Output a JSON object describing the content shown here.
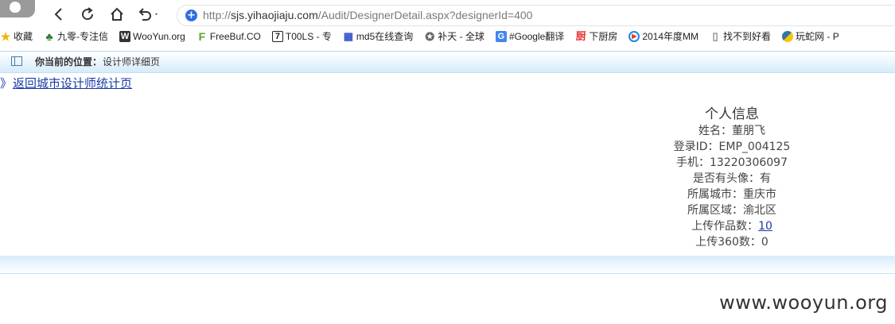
{
  "browser": {
    "url_prefix": "http://",
    "url_host": "sjs.yihaojiaju.com",
    "url_path": "/Audit/DesignerDetail.aspx?designerId=400"
  },
  "bookmarks": [
    {
      "label": "收藏",
      "icon": "star-icon",
      "color": "#f4b400"
    },
    {
      "label": "九零-专注信",
      "icon": "turtle-icon",
      "color": "#2e7d32"
    },
    {
      "label": "WooYun.org",
      "icon": "wooyun-icon",
      "color": "#333333"
    },
    {
      "label": "FreeBuf.CO",
      "icon": "freebuf-icon",
      "color": "#5aa02c"
    },
    {
      "label": "T00LS - 专",
      "icon": "tools-icon",
      "color": "#222222"
    },
    {
      "label": "md5在线查询",
      "icon": "grid-icon",
      "color": "#3355cc"
    },
    {
      "label": "补天 - 全球",
      "icon": "gear-star-icon",
      "color": "#666666"
    },
    {
      "label": "#Google翻译",
      "icon": "translate-icon",
      "color": "#4285f4"
    },
    {
      "label": "下厨房",
      "icon": "kitchen-icon",
      "color": "#e53935"
    },
    {
      "label": "2014年度MM",
      "icon": "play-icon",
      "color": "#1e88e5"
    },
    {
      "label": "找不到好看",
      "icon": "page-icon",
      "color": "#888888"
    },
    {
      "label": "玩蛇网 - P",
      "icon": "python-icon",
      "color": "#3572a5"
    }
  ],
  "location": {
    "label": "你当前的位置：",
    "value": "设计师详细页"
  },
  "back_link": {
    "arrow": "》",
    "label": "返回城市设计师统计页"
  },
  "profile": {
    "title": "个人信息",
    "name": "姓名：董朋飞",
    "login_id": "登录ID：EMP_004125",
    "phone": "手机：13220306097",
    "avatar": "是否有头像：有",
    "city": "所属城市：重庆市",
    "district": "所属区域：渝北区",
    "works_label": "上传作品数：",
    "works_count": "10",
    "upload360": "上传360数：0"
  },
  "watermark": "www.wooyun.org"
}
